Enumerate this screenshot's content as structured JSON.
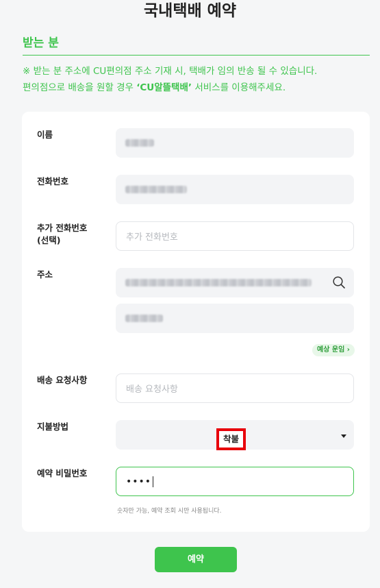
{
  "page": {
    "title": "국내택배 예약"
  },
  "section": {
    "title": "받는 분",
    "notice_line1": "※ 받는 분 주소에 CU편의점 주소 기재 시, 택배가 임의 반송 될 수 있습니다.",
    "notice_line2_pre": "편의점으로 배송을 원할 경우 ",
    "notice_line2_em": "‘CU알뜰택배’",
    "notice_line2_post": " 서비스를 이용해주세요."
  },
  "form": {
    "name": {
      "label": "이름"
    },
    "phone": {
      "label": "전화번호"
    },
    "extra_phone": {
      "label_line1": "추가 전화번호",
      "label_line2": "(선택)",
      "placeholder": "추가 전화번호"
    },
    "address": {
      "label": "주소",
      "fee_link": "예상 운임 ›"
    },
    "request": {
      "label": "배송 요청사항",
      "placeholder": "배송 요청사항"
    },
    "payment": {
      "label": "지불방법",
      "value": "착불"
    },
    "password": {
      "label": "예약 비밀번호",
      "value": "••••",
      "hint": "숫자만 가능, 예약 조회 시만 사용됩니다."
    }
  },
  "actions": {
    "submit_label": "예약"
  },
  "colors": {
    "accent": "#3ec44d",
    "highlight_box": "#e8000b"
  },
  "icons": {
    "address_search": "search-icon",
    "payment_dropdown": "caret-down-icon"
  }
}
